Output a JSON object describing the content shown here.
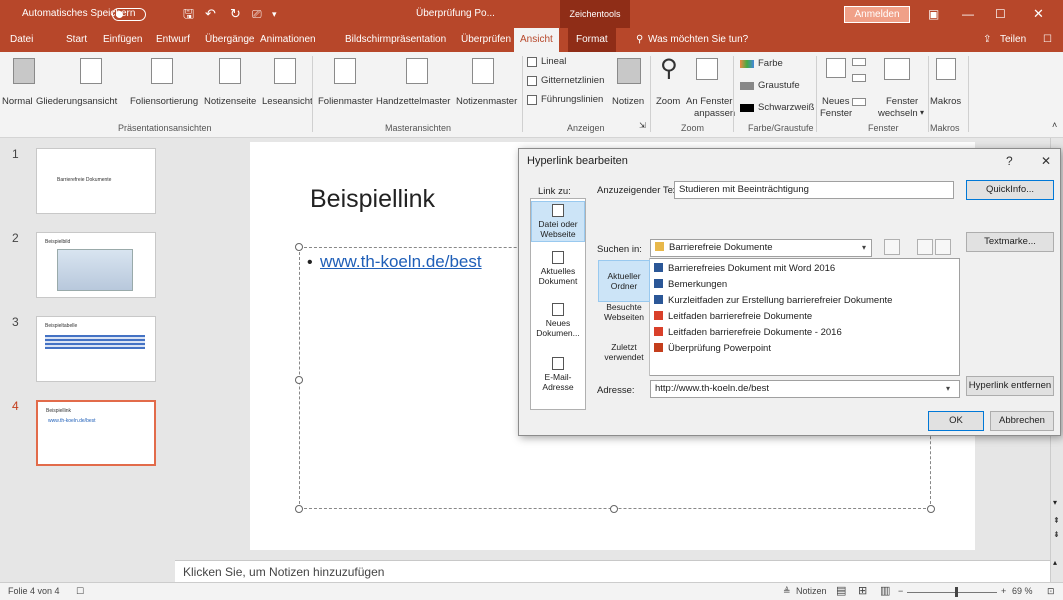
{
  "titlebar": {
    "autosave": "Automatisches Speichern",
    "autosave_state": "Aus",
    "doc_title": "Überprüfung Po...",
    "context_tools": "Zeichentools",
    "signin": "Anmelden"
  },
  "tabs": [
    "Datei",
    "Start",
    "Einfügen",
    "Entwurf",
    "Übergänge",
    "Animationen",
    "Bildschirmpräsentation",
    "Überprüfen",
    "Ansicht",
    "Format"
  ],
  "tell_me": "Was möchten Sie tun?",
  "share": "Teilen",
  "ribbon": {
    "views": [
      "Normal",
      "Gliederungsansicht",
      "Foliensortierung",
      "Notizenseite",
      "Leseansicht"
    ],
    "views_label": "Präsentationsansichten",
    "masters": [
      "Folienmaster",
      "Handzettelmaster",
      "Notizenmaster"
    ],
    "masters_label": "Masteransichten",
    "show": [
      "Lineal",
      "Gitternetzlinien",
      "Führungslinien"
    ],
    "notes_btn": "Notizen",
    "show_label": "Anzeigen",
    "zoom_btn": "Zoom",
    "fit_btn_1": "An Fenster",
    "fit_btn_2": "anpassen",
    "zoom_label": "Zoom",
    "color": [
      "Farbe",
      "Graustufe",
      "Schwarzweiß"
    ],
    "color_label": "Farbe/Graustufe",
    "new_window_1": "Neues",
    "new_window_2": "Fenster",
    "switch_window_1": "Fenster",
    "switch_window_2": "wechseln",
    "window_label": "Fenster",
    "macros_btn": "Makros",
    "macros_label": "Makros"
  },
  "thumbnails": [
    {
      "num": "1",
      "title": "Barrierefreie Dokumente"
    },
    {
      "num": "2",
      "title": "Beispielbild"
    },
    {
      "num": "3",
      "title": "Beispieltabelle"
    },
    {
      "num": "4",
      "title": "Beispiellink",
      "sub": "www.th-koeln.de/best"
    }
  ],
  "slide": {
    "title": "Beispiellink",
    "link": "www.th-koeln.de/best"
  },
  "notes_placeholder": "Klicken Sie, um Notizen hinzuzufügen",
  "statusbar": {
    "slide_info": "Folie 4 von 4",
    "notes": "Notizen",
    "zoom": "69 %"
  },
  "dialog": {
    "title": "Hyperlink bearbeiten",
    "help": "?",
    "close": "✕",
    "link_to_label": "Link zu:",
    "link_to": [
      {
        "label_1": "Datei oder",
        "label_2": "Webseite"
      },
      {
        "label_1": "Aktuelles",
        "label_2": "Dokument"
      },
      {
        "label_1": "Neues",
        "label_2": "Dokumen..."
      },
      {
        "label_1": "E-Mail-Adresse",
        "label_2": ""
      }
    ],
    "display_text_label": "Anzuzeigender Text:",
    "display_text": "Studieren mit Beeinträchtigung",
    "quickinfo": "QuickInfo...",
    "look_in_label": "Suchen in:",
    "look_in": "Barrierefreie Dokumente",
    "bookmark": "Textmarke...",
    "tabs": [
      {
        "label_1": "Aktueller",
        "label_2": "Ordner"
      },
      {
        "label_1": "Besuchte",
        "label_2": "Webseiten"
      },
      {
        "label_1": "Zuletzt",
        "label_2": "verwendet"
      }
    ],
    "files": [
      {
        "name": "Barrierefreies Dokument mit Word 2016",
        "type": "word"
      },
      {
        "name": "Bemerkungen",
        "type": "word"
      },
      {
        "name": "Kurzleitfaden zur Erstellung barrierefreier Dokumente",
        "type": "word"
      },
      {
        "name": "Leitfaden barrierefreie Dokumente",
        "type": "pdf"
      },
      {
        "name": "Leitfaden barrierefreie Dokumente - 2016",
        "type": "pdf"
      },
      {
        "name": "Überprüfung Powerpoint",
        "type": "ppt"
      }
    ],
    "address_label": "Adresse:",
    "address": "http://www.th-koeln.de/best",
    "remove_link": "Hyperlink entfernen",
    "ok": "OK",
    "cancel": "Abbrechen"
  },
  "colors": {
    "accent": "#b7472a",
    "dialog_bg": "#f0f0f0",
    "link": "#1f5fb8",
    "selection": "#cce4f7"
  }
}
